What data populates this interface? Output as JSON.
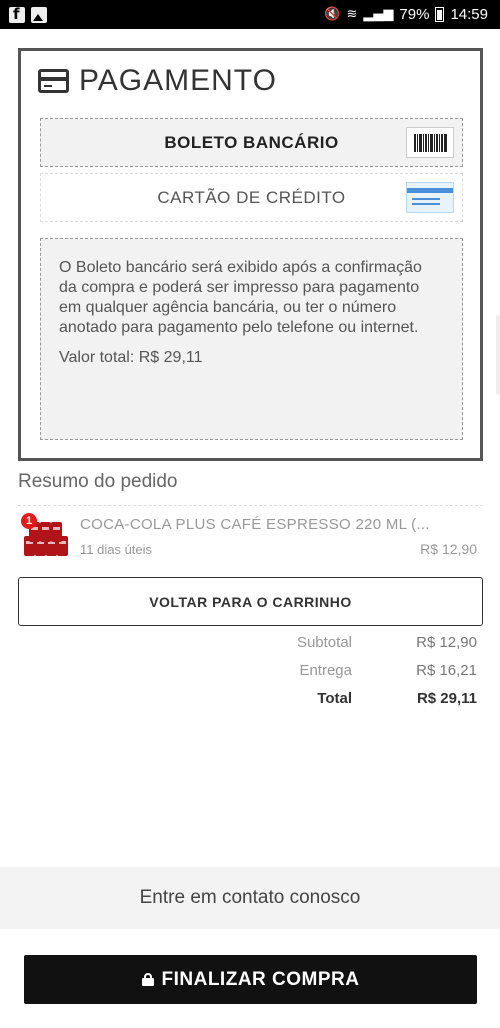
{
  "status_bar": {
    "battery": "79%",
    "time": "14:59"
  },
  "payment": {
    "title": "PAGAMENTO",
    "options": [
      {
        "label": "BOLETO BANCÁRIO",
        "icon": "barcode-icon",
        "selected": true
      },
      {
        "label": "CARTÃO DE CRÉDITO",
        "icon": "credit-card-icon",
        "selected": false
      }
    ],
    "boleto_info": "O Boleto bancário será exibido após a confirmação da compra e poderá ser impresso para pagamento em qualquer agência bancária, ou ter o número anotado para pagamento pelo telefone ou internet.",
    "total_line": "Valor total: R$ 29,11"
  },
  "summary": {
    "title": "Resumo do pedido",
    "item": {
      "quantity": "1",
      "name": "COCA-COLA PLUS CAFÉ ESPRESSO 220 ML (...",
      "delivery": "11 dias úteis",
      "price": "R$ 12,90"
    }
  },
  "back_button": "VOLTAR PARA O CARRINHO",
  "totals": {
    "subtotal_label": "Subtotal",
    "subtotal_value": "R$ 12,90",
    "delivery_label": "Entrega",
    "delivery_value": "R$ 16,21",
    "total_label": "Total",
    "total_value": "R$ 29,11"
  },
  "contact": "Entre em contato conosco",
  "finalize_button": "FINALIZAR COMPRA",
  "colors": {
    "finalize_bg": "#111111",
    "badge": "#e21b1b",
    "card_accent": "#4a90d9"
  }
}
